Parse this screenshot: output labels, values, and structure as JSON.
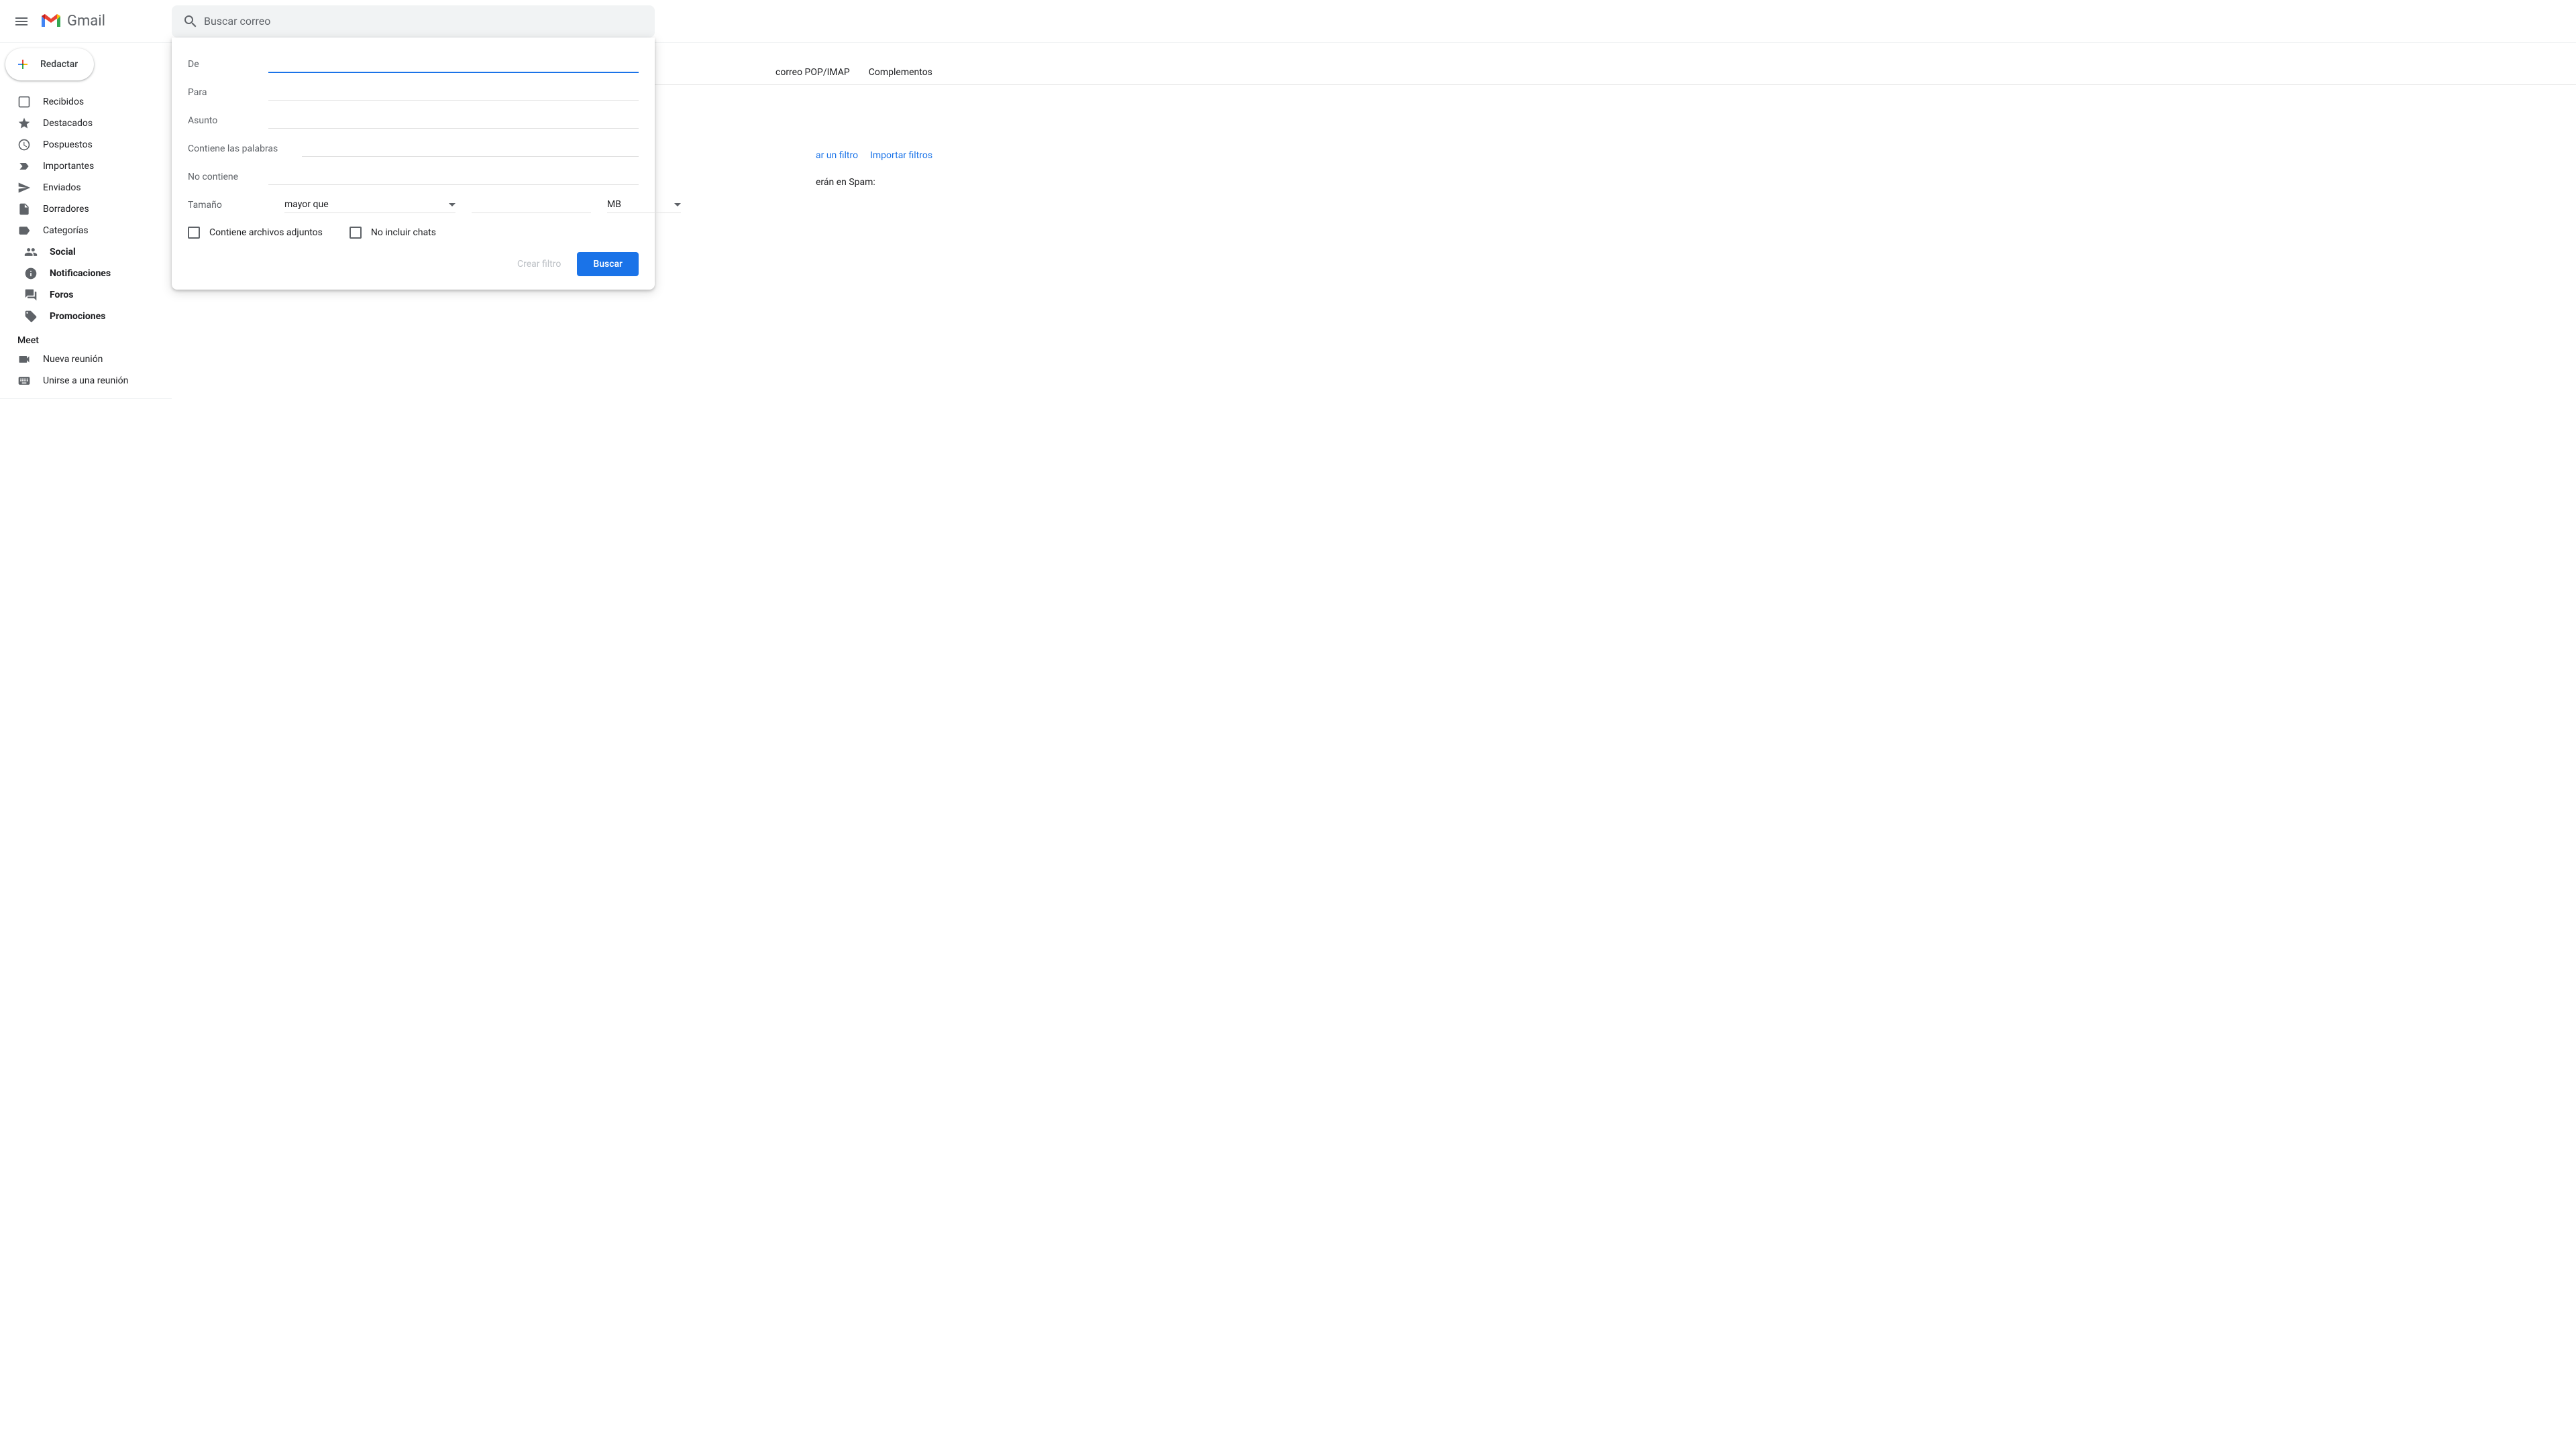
{
  "header": {
    "product_name": "Gmail",
    "search_placeholder": "Buscar correo"
  },
  "compose": {
    "label": "Redactar"
  },
  "sidebar": {
    "items": [
      {
        "label": "Recibidos"
      },
      {
        "label": "Destacados"
      },
      {
        "label": "Pospuestos"
      },
      {
        "label": "Importantes"
      },
      {
        "label": "Enviados"
      },
      {
        "label": "Borradores"
      },
      {
        "label": "Categorías"
      }
    ],
    "categories": [
      {
        "label": "Social"
      },
      {
        "label": "Notificaciones"
      },
      {
        "label": "Foros"
      },
      {
        "label": "Promociones"
      }
    ],
    "meet_header": "Meet",
    "meet_items": [
      {
        "label": "Nueva reunión"
      },
      {
        "label": "Unirse a una reunión"
      }
    ]
  },
  "search_panel": {
    "from_label": "De",
    "to_label": "Para",
    "subject_label": "Asunto",
    "has_words_label": "Contiene las palabras",
    "not_has_label": "No contiene",
    "size_label": "Tamaño",
    "size_op": "mayor que",
    "size_unit": "MB",
    "attach_label": "Contiene archivos adjuntos",
    "no_chats_label": "No incluir chats",
    "create_filter": "Crear filtro",
    "search_btn": "Buscar"
  },
  "settings": {
    "tab_pop": "correo POP/IMAP",
    "tab_addons": "Complementos",
    "link_create_filter_partial": "ar un filtro",
    "link_import_filters": "Importar filtros",
    "spam_text_partial": "erán en Spam:"
  }
}
